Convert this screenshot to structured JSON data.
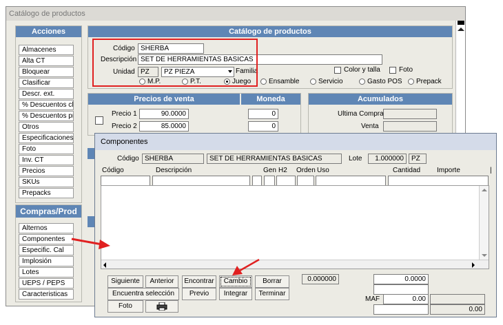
{
  "main_window": {
    "title": "Catálogo de productos",
    "acciones_header": "Acciones",
    "acciones": [
      "Almacenes",
      "Alta CT",
      "Bloquear",
      "Clasificar",
      "Descr. ext.",
      "% Descuentos clis",
      "% Descuentos prv",
      "Otros",
      "Especificaciones",
      "Foto",
      "Inv. CT",
      "Precios",
      "SKUs",
      "Prepacks"
    ],
    "compras_header": "Compras/Prod",
    "compras": [
      "Alternos",
      "Componentes",
      "Especific. Cal",
      "Implosión",
      "Lotes",
      "UEPS / PEPS",
      "Caracteristicas"
    ],
    "catalog_header": "Catálogo de productos",
    "codigo_label": "Código",
    "codigo_value": "SHERBA",
    "descripcion_label": "Descripción",
    "descripcion_value": "SET DE HERRAMIENTAS BASICAS",
    "unidad_label": "Unidad",
    "unidad_code": "PZ",
    "unidad_select": "PZ  PIEZA",
    "familia_label": "Familia",
    "color_talla_label": "Color y talla",
    "foto_label": "Foto",
    "radios": [
      {
        "label": "M.P.",
        "selected": false
      },
      {
        "label": "P.T.",
        "selected": false
      },
      {
        "label": "Juego",
        "selected": true
      },
      {
        "label": "Ensamble",
        "selected": false
      },
      {
        "label": "Servicio",
        "selected": false
      },
      {
        "label": "Gasto POS",
        "selected": false
      },
      {
        "label": "Prepack",
        "selected": false
      }
    ],
    "precios_header": "Precios de venta",
    "moneda_header": "Moneda",
    "acumulados_header": "Acumulados",
    "precio1_label": "Precio 1",
    "precio1_value": "90.0000",
    "precio1_moneda": "0",
    "precio2_label": "Precio 2",
    "precio2_value": "85.0000",
    "precio2_moneda": "0",
    "ultima_compra_label": "Ultima Compra",
    "venta_label": "Venta"
  },
  "componentes": {
    "title": "Componentes",
    "codigo_label": "Código",
    "codigo_value": "SHERBA",
    "descripcion_value": "SET DE HERRAMIENTAS BASICAS",
    "lote_label": "Lote",
    "lote_value": "1.000000",
    "unit_value": "PZ",
    "columns": [
      "Código",
      "Descripción",
      "Gen",
      "H2",
      "Orden",
      "Uso",
      "Cantidad",
      "Importe"
    ],
    "buttons_row1": [
      "Siguiente",
      "Anterior",
      "Encontrar",
      "Cambio",
      "Borrar"
    ],
    "buttons_row2": [
      "Encuentra selección",
      "Previo",
      "Integrar",
      "Terminar"
    ],
    "foto_button": "Foto",
    "small_value": "0.000000",
    "total1": "0.0000",
    "maf_label": "MAF",
    "maf_value": "0.00",
    "bottom_value": "0.00"
  },
  "colors": {
    "highlight": "#e02020",
    "arrow": "#e02020",
    "header_blue": "#5f86b5"
  }
}
